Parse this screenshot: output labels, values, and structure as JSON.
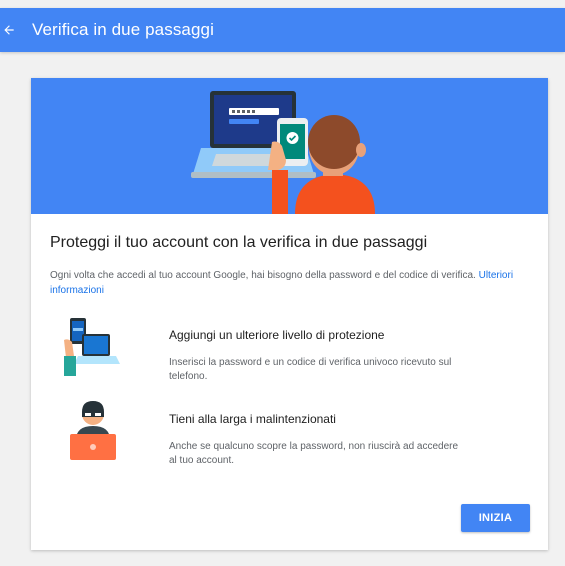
{
  "header": {
    "title": "Verifica in due passaggi",
    "back_icon": "arrow-back-icon",
    "color": "#4285f4"
  },
  "card": {
    "heading": "Proteggi il tuo account con la verifica in due passaggi",
    "description": "Ogni volta che accedi al tuo account Google, hai bisogno della password e del codice di verifica.",
    "learn_more_link": "Ulteriori informazioni",
    "features": [
      {
        "icon": "phone-laptop-icon",
        "title": "Aggiungi un ulteriore livello di protezione",
        "text": "Inserisci la password e un codice di verifica univoco ricevuto sul telefono."
      },
      {
        "icon": "burglar-laptop-icon",
        "title": "Tieni alla larga i malintenzionati",
        "text": "Anche se qualcuno scopre la password, non riuscirà ad accedere al tuo account."
      }
    ],
    "start_button": "INIZIA"
  },
  "colors": {
    "accent": "#4285f4",
    "link": "#1a73e8",
    "background": "#f1f1f1"
  }
}
